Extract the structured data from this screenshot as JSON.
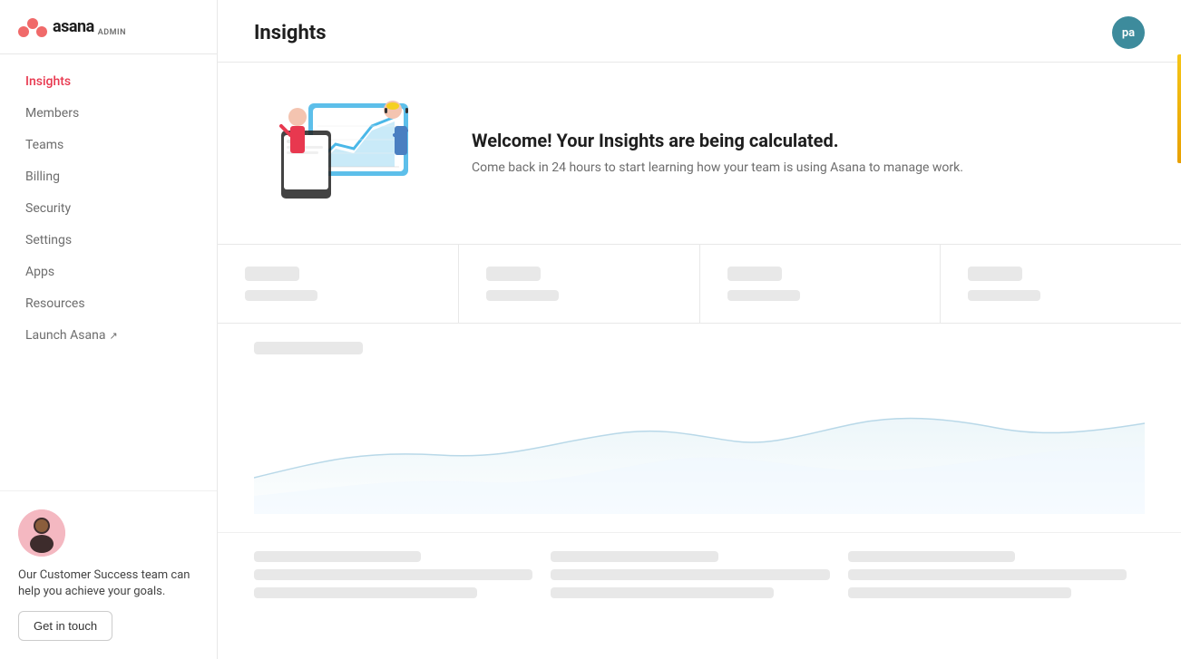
{
  "sidebar": {
    "logo": {
      "text": "asana",
      "admin_label": "ADMIN"
    },
    "nav_items": [
      {
        "id": "insights",
        "label": "Insights",
        "active": true
      },
      {
        "id": "members",
        "label": "Members",
        "active": false
      },
      {
        "id": "teams",
        "label": "Teams",
        "active": false
      },
      {
        "id": "billing",
        "label": "Billing",
        "active": false
      },
      {
        "id": "security",
        "label": "Security",
        "active": false
      },
      {
        "id": "settings",
        "label": "Settings",
        "active": false
      },
      {
        "id": "apps",
        "label": "Apps",
        "active": false
      },
      {
        "id": "resources",
        "label": "Resources",
        "active": false
      }
    ],
    "launch_label": "Launch Asana",
    "support": {
      "text": "Our Customer Success team can help you achieve your goals.",
      "button_label": "Get in touch"
    }
  },
  "header": {
    "title": "Insights",
    "user_initials": "pa"
  },
  "welcome": {
    "heading": "Welcome! Your Insights are being calculated.",
    "subtext": "Come back in 24 hours to start learning how your team is using Asana to manage work."
  },
  "icons": {
    "external_link": "↗"
  }
}
